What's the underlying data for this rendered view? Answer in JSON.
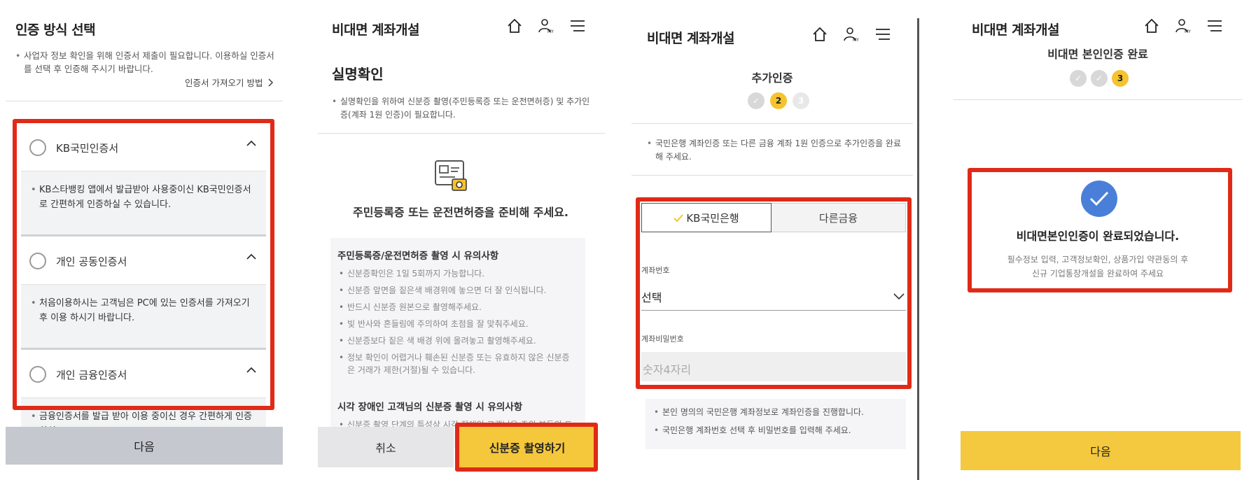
{
  "panel1": {
    "title": "인증 방식 선택",
    "notice": "사업자 정보 확인을 위해 인증서 제출이 필요합니다. 이용하실 인증서를 선택 후 인증해 주시기 바랍니다.",
    "link": "인증서 가져오기 방법",
    "certs": [
      {
        "label": "KB국민인증서",
        "desc": "KB스타뱅킹 앱에서 발급받아 사용중이신 KB국민인증서로 간편하게 인증하실 수 있습니다."
      },
      {
        "label": "개인 공동인증서",
        "desc": "처음이용하시는 고객님은 PC에 있는 인증서를 가져오기 후 이용 하시기 바랍니다."
      },
      {
        "label": "개인 금융인증서",
        "desc": "금융인증서를 발급 받아 이용 중이신 경우 간편하게 인증 하실"
      }
    ],
    "next_button": "다음"
  },
  "panel2": {
    "title": "비대면 계좌개설",
    "section_title": "실명확인",
    "notice": "실명확인을 위하여 신분증 촬영(주민등록증 또는 운전면허증) 및 추가인증(계좌 1원 인증)이 필요합니다.",
    "prepare_text": "주민등록증 또는 운전면허증을 준비해 주세요.",
    "caution_title": "주민등록증/운전면허증 촬영 시 유의사항",
    "cautions": [
      "신분증확인은 1일 5회까지 가능합니다.",
      "신분증 앞면을 짙은색 배경위에 놓으면 더 잘 인식됩니다.",
      "반드시 신분증 원본으로 촬영해주세요.",
      "빛 반사와 흔들림에 주의하여 초점을 잘 맞춰주세요.",
      "신분증보다 짙은 색 배경 위에 올려놓고 촬영해주세요.",
      "정보 확인이 어렵거나 훼손된 신분증 또는 유효하지 않은 신분증은 거래가 제한(거절)될 수 있습니다."
    ],
    "caution_title2": "시각 장애인 고객님의 신분증 촬영 시 유의사항",
    "caution2_partial": "신분증 촬영 단계의 특성상 시각 장애인 고객님은 주위 분들의 도",
    "cancel_button": "취소",
    "capture_button": "신분증 촬영하기"
  },
  "panel3": {
    "title": "비대면 계좌개설",
    "step_title": "추가인증",
    "steps": [
      "✓",
      "2",
      "3"
    ],
    "notice": "국민은행 계좌인증 또는 다른 금융 계좌 1원 인증으로 추가인증을 완료해 주세요.",
    "tab_kb": "KB국민은행",
    "tab_other": "다른금융",
    "account_label": "계좌번호",
    "account_value": "선택",
    "pw_label": "계좌비밀번호",
    "pw_placeholder": "숫자4자리",
    "info": [
      "본인 명의의 국민은행 계좌정보로 계좌인증을 진행합니다.",
      "국민은행 계좌번호 선택 후 비밀번호를 입력해 주세요."
    ]
  },
  "panel4": {
    "title": "비대면 계좌개설",
    "step_title": "비대면 본인인증 완료",
    "steps": [
      "✓",
      "✓",
      "3"
    ],
    "done_title": "비대면본인인증이 완료되었습니다.",
    "done_desc1": "필수정보 입력, 고객정보확인, 상품가입 약관동의 후",
    "done_desc2": "신규 기업통장개설을 완료하여 주세요",
    "next_button": "다음"
  },
  "icons": [
    "home-icon",
    "my-icon",
    "menu-icon",
    "chevron-up-icon",
    "chevron-right-icon",
    "chevron-down-icon",
    "id-card-camera-icon",
    "check-icon"
  ],
  "colors": {
    "highlight": "#e02a17",
    "accent": "#f5c32e",
    "check_blue": "#4a7fd9",
    "grey_button": "#c5c8ce"
  }
}
